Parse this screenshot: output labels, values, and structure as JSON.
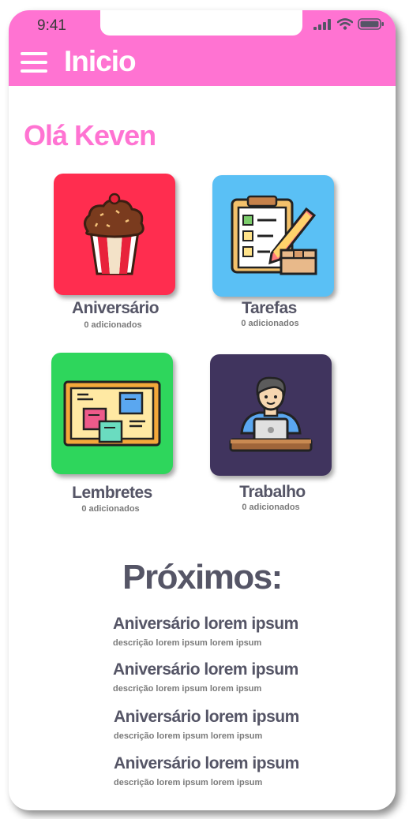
{
  "status_bar": {
    "time": "9:41",
    "icons": [
      "signal-icon",
      "wifi-icon",
      "battery-icon"
    ]
  },
  "header": {
    "title": "Inicio",
    "menu_icon": "hamburger-menu-icon",
    "color": "#ff73d2"
  },
  "greeting": "Olá Keven",
  "categories": [
    {
      "title": "Aniversário",
      "count": "0 adicionados",
      "icon": "cupcake-icon",
      "color": "#ff2d4f"
    },
    {
      "title": "Tarefas",
      "count": "0 adicionados",
      "icon": "checklist-pencil-icon",
      "color": "#5ac0f5"
    },
    {
      "title": "Lembretes",
      "count": "0 adicionados",
      "icon": "sticky-notes-board-icon",
      "color": "#2ed65c"
    },
    {
      "title": "Trabalho",
      "count": "0 adicionados",
      "icon": "person-laptop-icon",
      "color": "#40345e"
    }
  ],
  "upcoming": {
    "title": "Próximos:",
    "events": [
      {
        "title": "Aniversário lorem ipsum",
        "description": "descrição lorem ipsum lorem ipsum"
      },
      {
        "title": "Aniversário lorem ipsum",
        "description": "descrição lorem ipsum lorem ipsum"
      },
      {
        "title": "Aniversário lorem ipsum",
        "description": "descrição lorem ipsum lorem ipsum"
      },
      {
        "title": "Aniversário lorem ipsum",
        "description": "descrição lorem ipsum lorem ipsum"
      }
    ]
  }
}
